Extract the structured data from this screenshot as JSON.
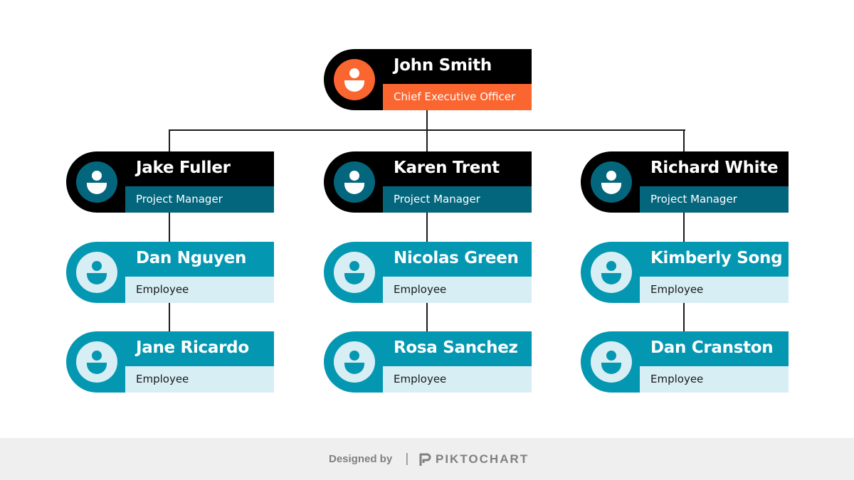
{
  "colors": {
    "black": "#000000",
    "orange": "#fb6530",
    "dark_teal": "#04667d",
    "teal": "#0497b2",
    "light_blue": "#d7eef4"
  },
  "org": {
    "ceo": {
      "name": "John Smith",
      "role": "Chief Executive Officer",
      "icon": "user-icon"
    },
    "columns": [
      {
        "manager": {
          "name": "Jake Fuller",
          "role": "Project Manager"
        },
        "employees": [
          {
            "name": "Dan Nguyen",
            "role": "Employee"
          },
          {
            "name": "Jane Ricardo",
            "role": "Employee"
          }
        ]
      },
      {
        "manager": {
          "name": "Karen Trent",
          "role": "Project Manager"
        },
        "employees": [
          {
            "name": "Nicolas Green",
            "role": "Employee"
          },
          {
            "name": "Rosa Sanchez",
            "role": "Employee"
          }
        ]
      },
      {
        "manager": {
          "name": "Richard White",
          "role": "Project Manager"
        },
        "employees": [
          {
            "name": "Kimberly Song",
            "role": "Employee"
          },
          {
            "name": "Dan Cranston",
            "role": "Employee"
          }
        ]
      }
    ]
  },
  "footer": {
    "designed_by": "Designed by",
    "separator": "|",
    "brand": "PIKTOCHART",
    "logo_icon": "piktochart-logo-icon"
  }
}
